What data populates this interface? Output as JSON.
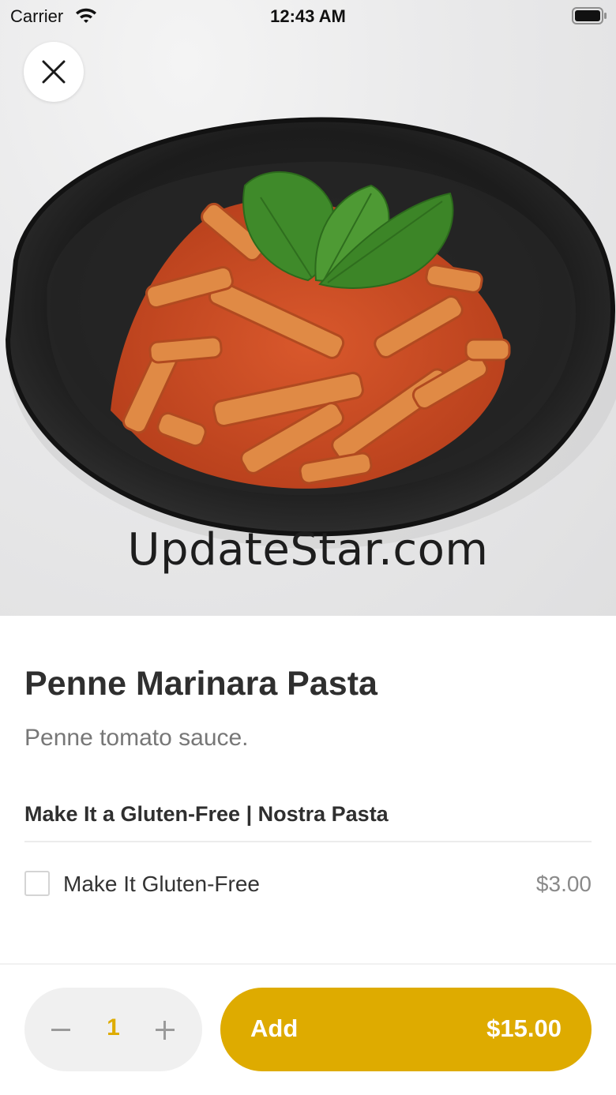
{
  "status_bar": {
    "carrier": "Carrier",
    "time": "12:43 AM",
    "wifi_icon": "wifi-icon",
    "battery_icon": "battery-icon"
  },
  "hero": {
    "image_subject": "penne-pasta-dish",
    "watermark": "UpdateStar.com"
  },
  "close_button": {
    "icon": "close-icon"
  },
  "item": {
    "title": "Penne Marinara Pasta",
    "description": "Penne tomato sauce."
  },
  "option_group": {
    "title": "Make It a Gluten-Free | Nostra Pasta",
    "options": [
      {
        "label": "Make It Gluten-Free",
        "price": "$3.00",
        "checked": false
      }
    ]
  },
  "bottom_bar": {
    "quantity": "1",
    "minus_icon": "minus-icon",
    "plus_icon": "plus-icon",
    "add_label": "Add",
    "total_price": "$15.00"
  },
  "colors": {
    "accent": "#deab00",
    "quantity_text": "#deac00",
    "stepper_bg": "#f0f0f0",
    "title_text": "#2f2f2f",
    "muted_text": "#777777"
  }
}
